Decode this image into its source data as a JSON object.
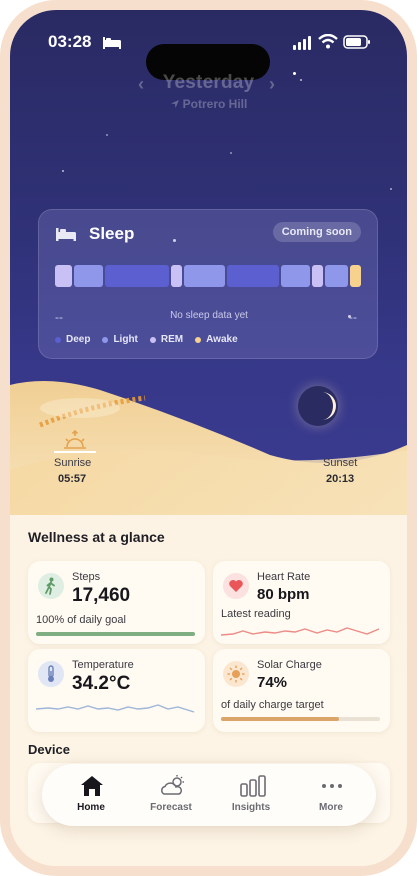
{
  "status": {
    "time": "03:28"
  },
  "nav": {
    "title": "Yesterday",
    "location": "Potrero Hill",
    "prev": "‹",
    "next": "›"
  },
  "sleep": {
    "title": "Sleep",
    "badge": "Coming soon",
    "empty_left": "--",
    "empty_right": "--",
    "empty_text": "No sleep data yet",
    "legend": [
      {
        "label": "Deep",
        "color": "#5b5fcf"
      },
      {
        "label": "Light",
        "color": "#8f97ea"
      },
      {
        "label": "REM",
        "color": "#c9c0f5"
      },
      {
        "label": "Awake",
        "color": "#f6d28e"
      }
    ],
    "stages": [
      "REM",
      "Light",
      "Deep",
      "REM",
      "Light",
      "Deep",
      "Light",
      "REM",
      "Light",
      "Awake"
    ]
  },
  "sun": {
    "sunrise_label": "Sunrise",
    "sunrise_time": "05:57",
    "sunset_label": "Sunset",
    "sunset_time": "20:13"
  },
  "wellness": {
    "title": "Wellness at a glance",
    "steps": {
      "label": "Steps",
      "value": "17,460",
      "sub": "100% of daily goal",
      "progress": 1.0,
      "color": "#7fae82"
    },
    "heart": {
      "label": "Heart Rate",
      "value": "80 bpm",
      "sub": "Latest reading",
      "color": "#e8565a"
    },
    "temp": {
      "label": "Temperature",
      "value": "34.2°C",
      "color": "#9fb6d8"
    },
    "solar": {
      "label": "Solar Charge",
      "value": "74%",
      "sub": "of daily charge target",
      "progress": 0.74,
      "color": "#dba56a"
    }
  },
  "device": {
    "title": "Device"
  },
  "tabs": [
    {
      "label": "Home",
      "icon": "home-icon",
      "active": true
    },
    {
      "label": "Forecast",
      "icon": "cloud-sun-icon",
      "active": false
    },
    {
      "label": "Insights",
      "icon": "bar-chart-icon",
      "active": false
    },
    {
      "label": "More",
      "icon": "more-icon",
      "active": false
    }
  ]
}
